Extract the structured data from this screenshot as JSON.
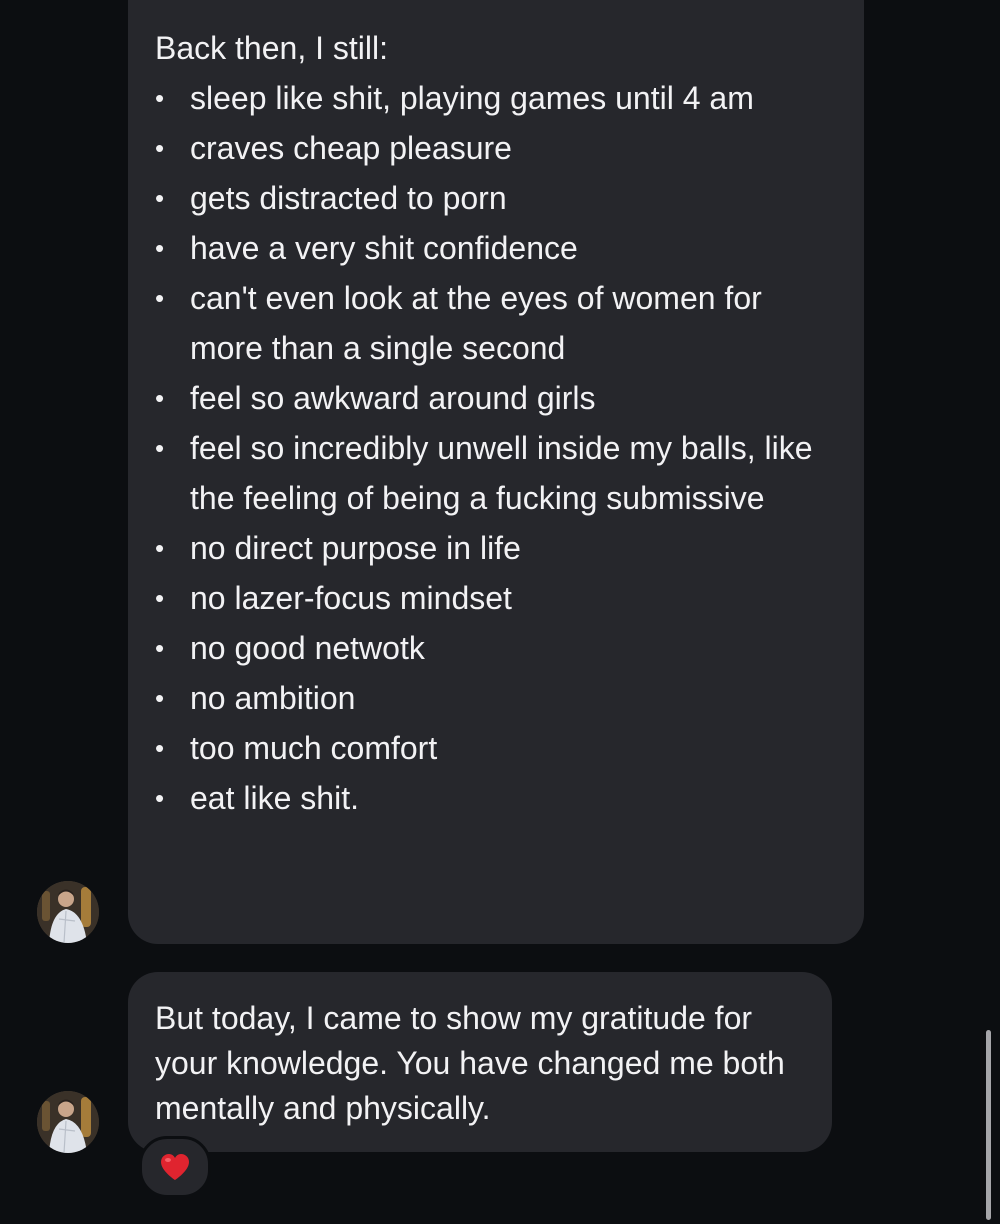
{
  "messages": [
    {
      "intro": "Back then, I still:",
      "bullet_symbol": "•",
      "items": [
        "sleep like shit, playing games until 4 am",
        "craves cheap pleasure",
        "gets distracted to porn",
        "have a very shit confidence",
        "can't even look at the eyes of women for more than a single second",
        "feel so awkward around girls",
        "feel so incredibly unwell inside my balls, like the feeling of being a fucking submissive",
        "no direct purpose in life",
        "no lazer-focus mindset",
        "no good netwotk",
        "no ambition",
        "too much comfort",
        "eat like shit."
      ]
    },
    {
      "text": "But today, I came to show my gratitude for your knowledge. You have changed me both mentally and physically.",
      "reaction_icon": "red-heart-icon"
    }
  ],
  "colors": {
    "background": "#0c0e11",
    "bubble": "#26272c",
    "text": "#f2f2f4",
    "heart": "#e0242f",
    "scrollbar": "#a6a6aa"
  }
}
